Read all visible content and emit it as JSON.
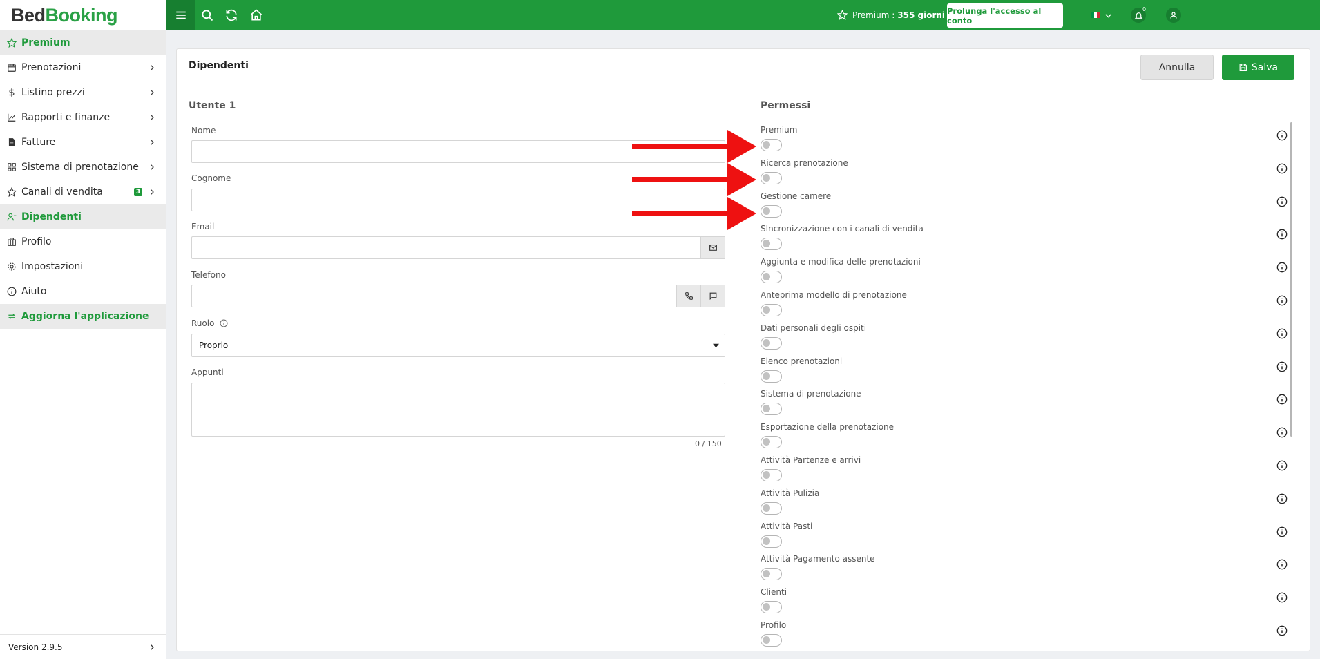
{
  "brand": {
    "part1": "Bed",
    "part2": "Booking",
    "color": "#1f9a3b"
  },
  "sidebar": {
    "items": [
      {
        "label": "Premium",
        "icon": "star-icon"
      },
      {
        "label": "Prenotazioni",
        "icon": "calendar-icon"
      },
      {
        "label": "Listino prezzi",
        "icon": "dollar-icon"
      },
      {
        "label": "Rapporti e finanze",
        "icon": "chart-icon"
      },
      {
        "label": "Fatture",
        "icon": "invoice-icon"
      },
      {
        "label": "Sistema di prenotazione",
        "icon": "grid-icon"
      },
      {
        "label": "Canali di vendita",
        "icon": "star-outline-icon",
        "badge": "3"
      },
      {
        "label": "Dipendenti",
        "icon": "employees-icon"
      },
      {
        "label": "Profilo",
        "icon": "building-icon"
      },
      {
        "label": "Impostazioni",
        "icon": "gear-icon"
      },
      {
        "label": "Aiuto",
        "icon": "help-icon"
      },
      {
        "label": "Aggiorna l'applicazione",
        "icon": "refresh-icon"
      }
    ],
    "version": "Version 2.9.5"
  },
  "topbar": {
    "premium_label": "Premium :",
    "premium_days": "355 giorni",
    "extend_button": "Prolunga l'accesso al conto",
    "notification_count": "0",
    "flag_colors": [
      "#009246",
      "#ffffff",
      "#ce2b37"
    ]
  },
  "page": {
    "title": "Dipendenti",
    "cancel_button": "Annulla",
    "save_button": "Salva"
  },
  "user_form": {
    "section_title": "Utente 1",
    "name_label": "Nome",
    "name_value": "",
    "surname_label": "Cognome",
    "surname_value": "",
    "email_label": "Email",
    "email_value": "",
    "phone_label": "Telefono",
    "phone_value": "",
    "role_label": "Ruolo",
    "role_value": "Proprio",
    "notes_label": "Appunti",
    "notes_counter": "0 / 150"
  },
  "permissions": {
    "section_title": "Permessi",
    "items": [
      {
        "label": "Premium",
        "enabled": false
      },
      {
        "label": "Ricerca prenotazione",
        "enabled": false
      },
      {
        "label": "Gestione camere",
        "enabled": false
      },
      {
        "label": "SIncronizzazione con i canali di vendita",
        "enabled": false
      },
      {
        "label": "Aggiunta e modifica delle prenotazioni",
        "enabled": false
      },
      {
        "label": "Anteprima modello di prenotazione",
        "enabled": false
      },
      {
        "label": "Dati personali degli ospiti",
        "enabled": false
      },
      {
        "label": "Elenco prenotazioni",
        "enabled": false
      },
      {
        "label": "Sistema di prenotazione",
        "enabled": false
      },
      {
        "label": "Esportazione della prenotazione",
        "enabled": false
      },
      {
        "label": "Attività Partenze e arrivi",
        "enabled": false
      },
      {
        "label": "Attività Pulizia",
        "enabled": false
      },
      {
        "label": "Attività Pasti",
        "enabled": false
      },
      {
        "label": "Attività Pagamento assente",
        "enabled": false
      },
      {
        "label": "Clienti",
        "enabled": false
      },
      {
        "label": "Profilo",
        "enabled": false
      }
    ]
  },
  "annotation": {
    "arrow_color": "#ee1111"
  }
}
